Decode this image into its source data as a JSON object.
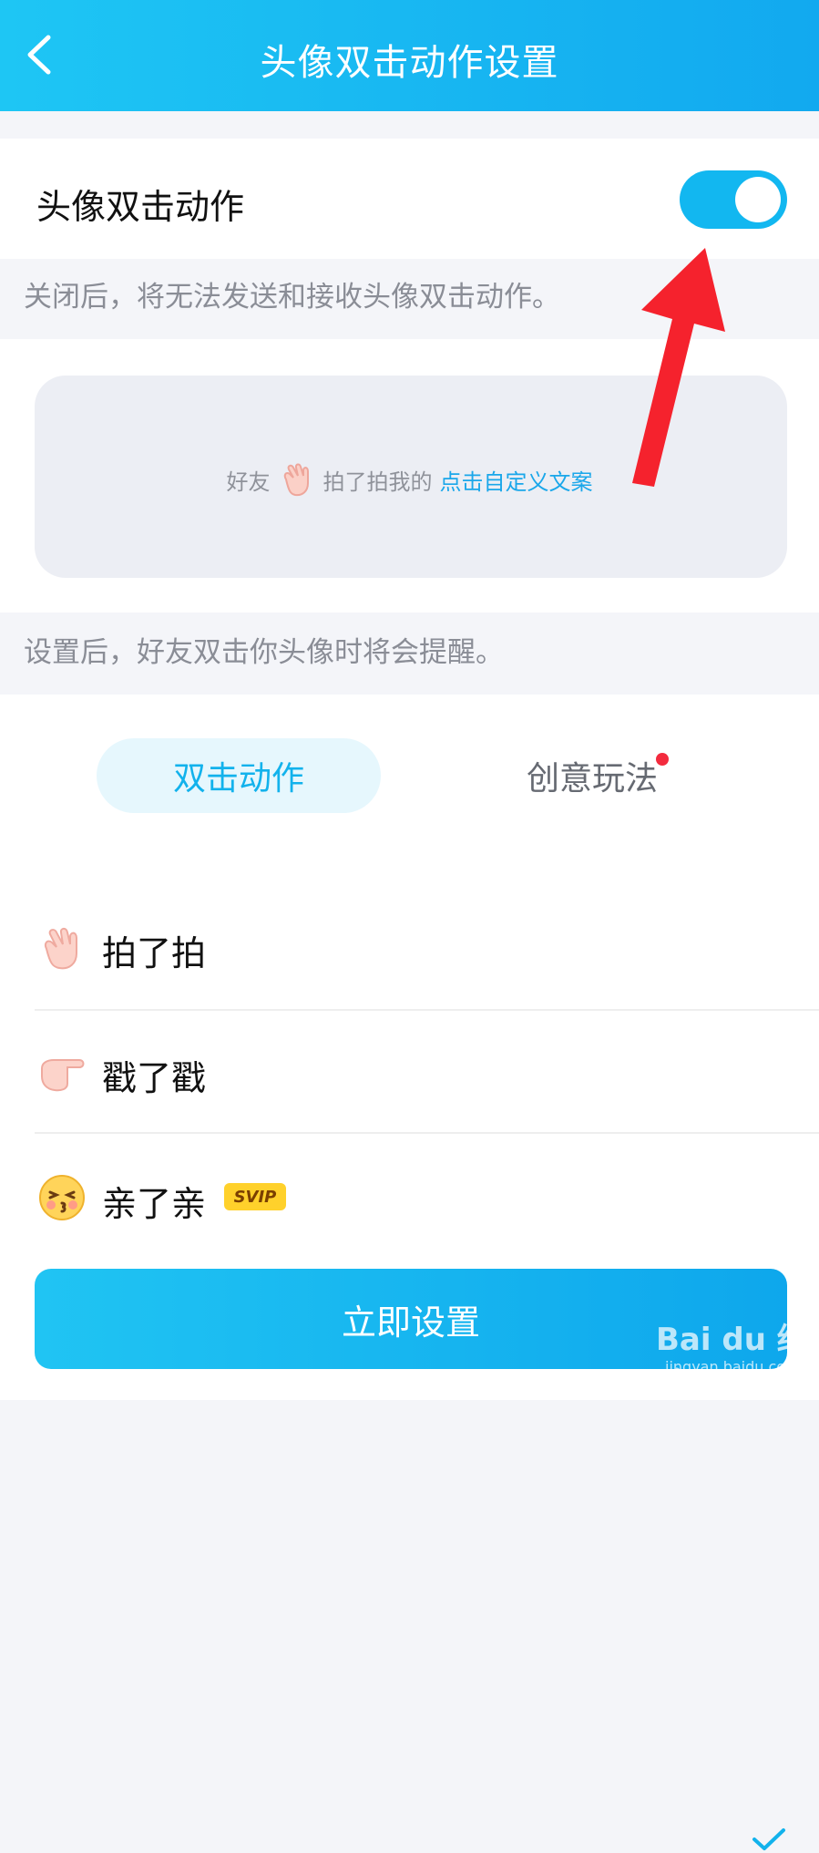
{
  "header": {
    "title": "头像双击动作设置",
    "back_icon": "chevron-left-icon"
  },
  "toggle": {
    "label": "头像双击动作",
    "enabled": true,
    "hint": "关闭后，将无法发送和接收头像双击动作。"
  },
  "preview": {
    "prefix": "好友",
    "icon": "waving-hand-icon",
    "middle": "拍了拍我的",
    "link": "点击自定义文案"
  },
  "preview_hint": "设置后，好友双击你头像时将会提醒。",
  "tabs": [
    {
      "label": "双击动作",
      "selected": true
    },
    {
      "label": "创意玩法",
      "selected": false,
      "badge": "red-dot"
    }
  ],
  "actions": [
    {
      "icon": "waving-hand-icon",
      "label": "拍了拍",
      "selected": true
    },
    {
      "icon": "pointing-hand-icon",
      "label": "戳了戳",
      "selected": false
    },
    {
      "icon": "kissing-face-icon",
      "label": "亲了亲",
      "badge": "SVIP",
      "selected": false
    }
  ],
  "button": {
    "label": "立即设置"
  },
  "watermark": {
    "main": "Bai du 经验",
    "sub": "jingyan.baidu.com"
  },
  "colors": {
    "accent": "#12b2ec",
    "annotation_arrow": "#f5222d",
    "svip": "#ffd12b"
  }
}
